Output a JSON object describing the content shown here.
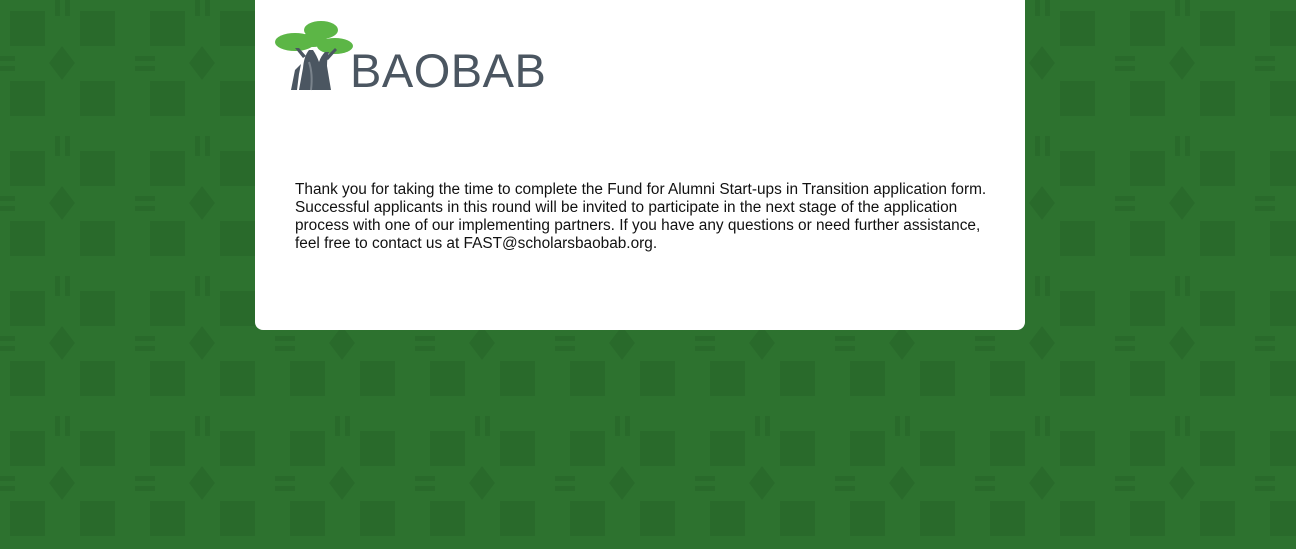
{
  "brand": {
    "name": "BAOBAB",
    "logo_icon": "baobab-tree-icon",
    "text_color": "#4b5661",
    "foliage_color": "#5cb646",
    "trunk_color": "#4b5661"
  },
  "background": {
    "base_color": "#2d722f",
    "pattern_color": "#2a6a2c"
  },
  "confirmation": {
    "message": "Thank you for taking the time to complete the Fund for Alumni Start-ups in Transition application form. Successful applicants in this round will be invited to participate in the next stage of the application process with one of our implementing partners. If you have any questions or need further assistance, feel free to contact us at FAST@scholarsbaobab.org."
  }
}
